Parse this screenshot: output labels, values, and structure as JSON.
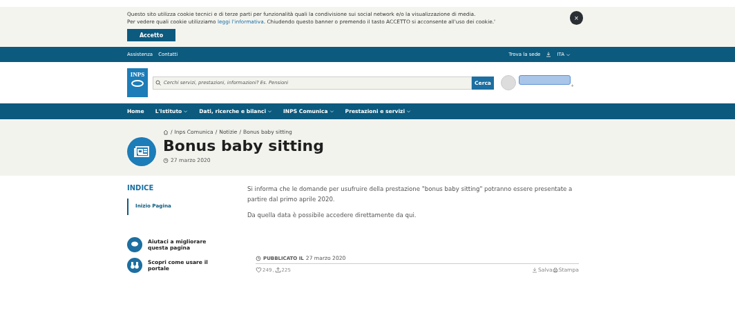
{
  "cookie_banner": {
    "line_1": "Questo sito utilizza cookie tecnici e di terze parti per funzionalità quali la condivisione sui social network e/o la visualizzazione di media.",
    "line_2_before": "Per vedere quali cookie utilizziamo",
    "link": "leggi l'informativa",
    "line_2_after": ". Chiudendo questo banner o premendo il tasto ACCETTO si acconsente all'uso dei cookie.'",
    "accept_button": "Accetto",
    "close_button": "×"
  },
  "top_bar": {
    "links": [
      "Assistenza",
      "Contatti"
    ],
    "find_office": "Trova la sede",
    "language": "ITA"
  },
  "header": {
    "logo": "INPS",
    "search": {
      "placeholder": "Cerchi servizi, prestazioni, informazioni? Es. Pensioni"
    },
    "search_button": "Cerca",
    "user_plus": "+"
  },
  "nav": [
    {
      "label": "Home",
      "dropdown": false
    },
    {
      "label": "L'Istituto",
      "dropdown": true
    },
    {
      "label": "Dati, ricerche e bilanci",
      "dropdown": true
    },
    {
      "label": "INPS Comunica",
      "dropdown": true
    },
    {
      "label": "Prestazioni e servizi",
      "dropdown": true
    }
  ],
  "breadcrumb": {
    "separator": "/",
    "items": [
      "Inps Comunica",
      "Notizie",
      "Bonus baby sitting"
    ]
  },
  "title": "Bonus baby sitting",
  "date": "27 marzo 2020",
  "index": {
    "title": "INDICE",
    "items": [
      {
        "label": "Inizio Pagina",
        "selected": true
      }
    ]
  },
  "side_links": [
    {
      "kind": "feedback",
      "label": "Aiutaci a migliorare questa pagina"
    },
    {
      "kind": "guide",
      "label": "Scopri come usare il portale"
    }
  ],
  "body": [
    "Si informa che le domande per usufruire della prestazione \"bonus baby sitting\" potranno essere presentate a partire dal primo aprile 2020.",
    "Da quella data è possibile accedere direttamente da qui."
  ],
  "published": {
    "label": "PUBBLICATO IL",
    "date": "27 marzo 2020"
  },
  "stats": {
    "likes": "249",
    "separator": ",",
    "shares": "225"
  },
  "actions": [
    "Salva",
    "Stampa"
  ]
}
